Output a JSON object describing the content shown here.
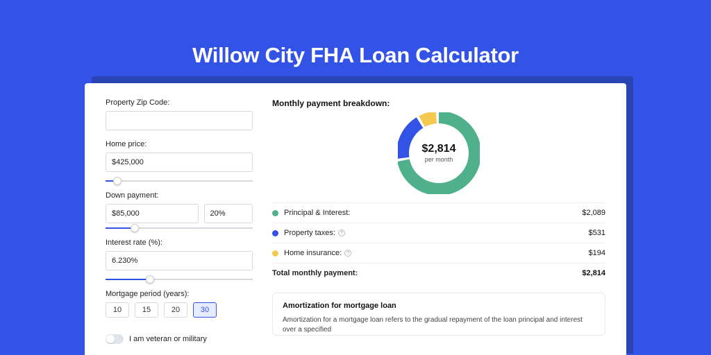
{
  "title": "Willow City FHA Loan Calculator",
  "colors": {
    "principal": "#4fb18c",
    "taxes": "#3253e6",
    "insurance": "#f4c94f"
  },
  "form": {
    "zip": {
      "label": "Property Zip Code:",
      "value": ""
    },
    "price": {
      "label": "Home price:",
      "value": "$425,000",
      "sliderPct": 8
    },
    "down": {
      "label": "Down payment:",
      "value": "$85,000",
      "pct": "20%",
      "sliderPct": 20
    },
    "rate": {
      "label": "Interest rate (%):",
      "value": "6.230%",
      "sliderPct": 30
    },
    "period": {
      "label": "Mortgage period (years):",
      "options": [
        "10",
        "15",
        "20",
        "30"
      ],
      "active": "30"
    },
    "veteran": {
      "label": "I am veteran or military",
      "on": false
    }
  },
  "breakdown": {
    "title": "Monthly payment breakdown:",
    "centerAmount": "$2,814",
    "centerSub": "per month",
    "rows": [
      {
        "key": "principal",
        "label": "Principal & Interest:",
        "value": "$2,089",
        "info": false
      },
      {
        "key": "taxes",
        "label": "Property taxes:",
        "value": "$531",
        "info": true
      },
      {
        "key": "insurance",
        "label": "Home insurance:",
        "value": "$194",
        "info": true
      }
    ],
    "total": {
      "label": "Total monthly payment:",
      "value": "$2,814"
    }
  },
  "amort": {
    "title": "Amortization for mortgage loan",
    "text": "Amortization for a mortgage loan refers to the gradual repayment of the loan principal and interest over a specified"
  },
  "chart_data": {
    "type": "pie",
    "title": "Monthly payment breakdown",
    "series": [
      {
        "name": "Principal & Interest",
        "value": 2089,
        "color": "#4fb18c"
      },
      {
        "name": "Property taxes",
        "value": 531,
        "color": "#3253e6"
      },
      {
        "name": "Home insurance",
        "value": 194,
        "color": "#f4c94f"
      }
    ],
    "total": 2814,
    "center_label": "$2,814 per month"
  }
}
